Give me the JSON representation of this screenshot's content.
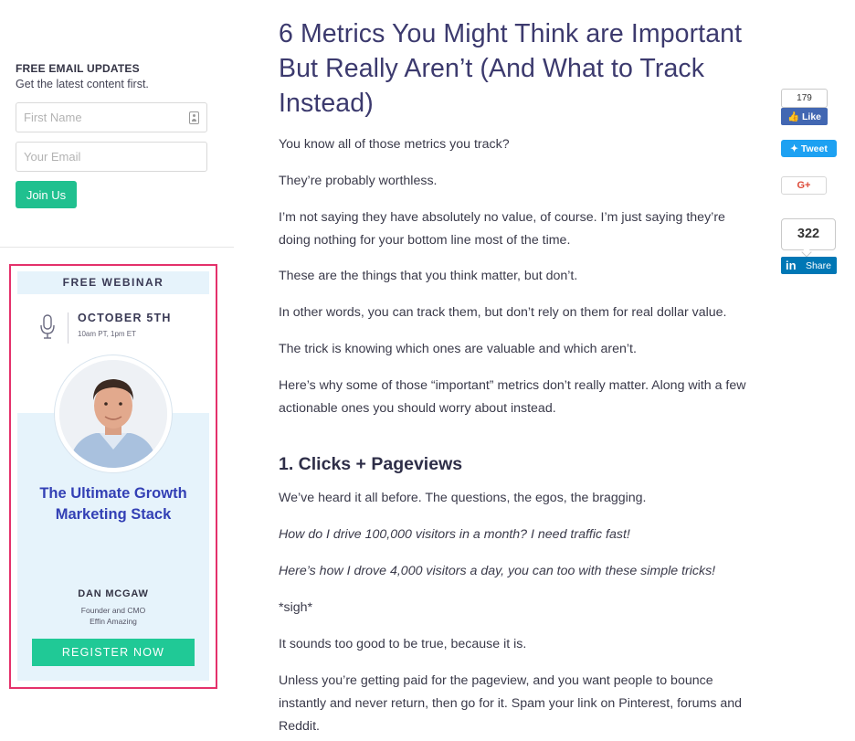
{
  "signup": {
    "heading": "FREE EMAIL UPDATES",
    "subheading": "Get the latest content first.",
    "first_name_placeholder": "First Name",
    "email_placeholder": "Your Email",
    "join_label": "Join Us",
    "accent_color": "#20c08f"
  },
  "webinar": {
    "header": "FREE WEBINAR",
    "date": "OCTOBER 5TH",
    "time": "10am PT, 1pm ET",
    "title": "The Ultimate Growth Marketing Stack",
    "speaker_name": "DAN MCGAW",
    "speaker_role": "Founder and CMO",
    "speaker_company": "Effin Amazing",
    "register_label": "REGISTER NOW",
    "border_color": "#e4316b",
    "icons": [
      "microphone-icon",
      "speaker-photo"
    ]
  },
  "article": {
    "title": "6 Metrics You Might Think are Important But Really Aren’t (And What to Track Instead)",
    "paragraphs": [
      "You know all of those metrics you track?",
      "They’re probably worthless.",
      "I’m not saying they have absolutely no value, of course. I’m just saying they’re doing nothing for your bottom line most of the time.",
      "These are the things that you think matter, but don’t.",
      "In other words, you can track them, but don’t rely on them for real dollar value.",
      "The trick is knowing which ones are valuable and which aren’t.",
      "Here’s why some of those “important” metrics don’t really matter. Along with a few actionable ones you should worry about instead."
    ],
    "section_1": {
      "heading": "1. Clicks + Pageviews",
      "paragraphs": [
        "We’ve heard it all before. The questions, the egos, the bragging.",
        "How do I drive 100,000 visitors in a month? I need traffic fast!",
        "Here’s how I drove 4,000 visitors a day, you can too with these simple tricks!",
        "*sigh*",
        "It sounds too good to be true, because it is.",
        "Unless you’re getting paid for the pageview, and you want people to bounce instantly and never return, then go for it. Spam your link on Pinterest, forums and Reddit."
      ]
    }
  },
  "social": {
    "facebook_count": "179",
    "facebook_label": "Like",
    "twitter_label": "Tweet",
    "gplus_label": "G+",
    "linkedin_count": "322",
    "linkedin_logo": "in",
    "linkedin_label": "Share",
    "colors": {
      "facebook": "#4267b2",
      "twitter": "#1da1f2",
      "gplus": "#dd4b39",
      "linkedin": "#0077b5"
    }
  }
}
